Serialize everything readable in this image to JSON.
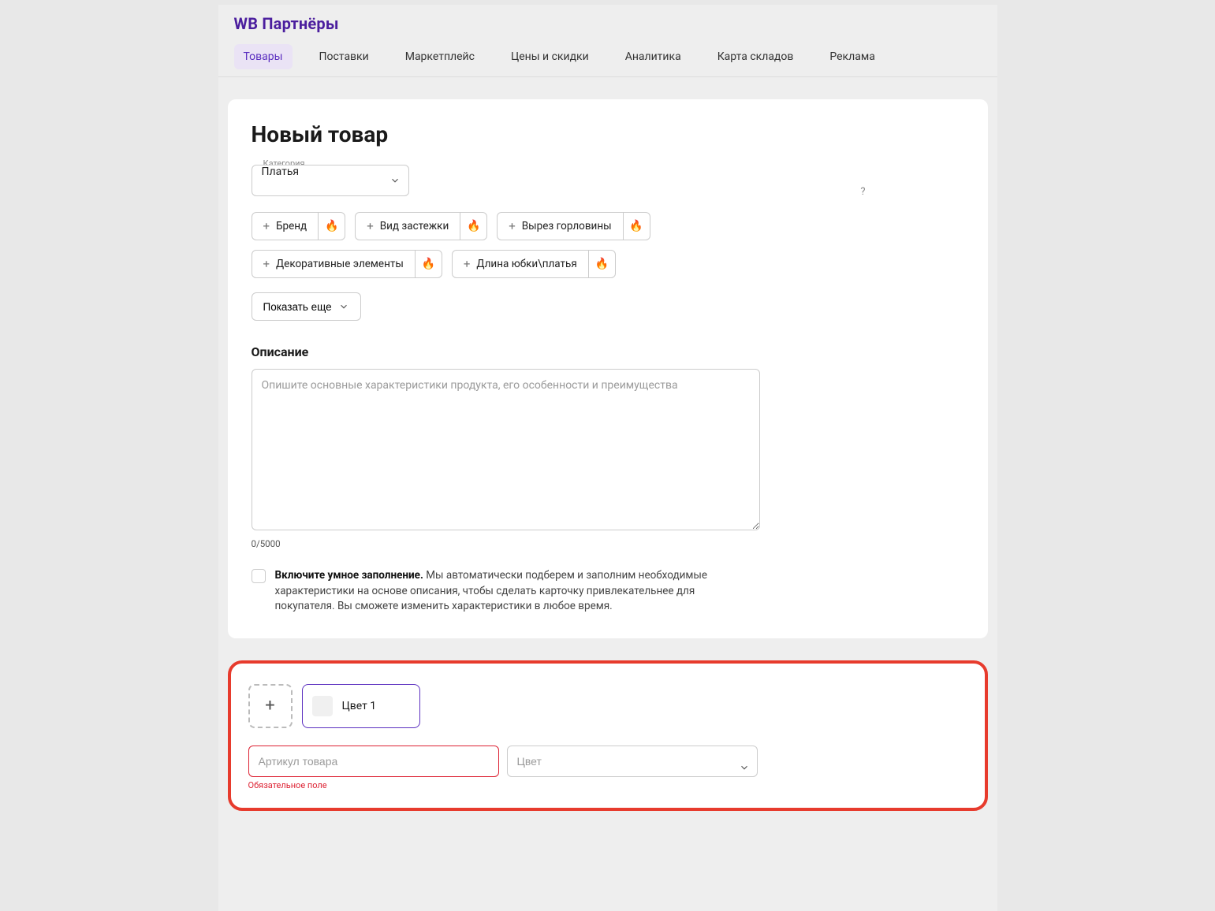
{
  "app_title": "WB Партнёры",
  "nav": {
    "tabs": [
      "Товары",
      "Поставки",
      "Маркетплейс",
      "Цены и скидки",
      "Аналитика",
      "Карта складов",
      "Реклама"
    ],
    "active_index": 0
  },
  "page_title": "Новый товар",
  "category": {
    "label": "Категория",
    "value": "Платья"
  },
  "attr_chips": [
    "Бренд",
    "Вид застежки",
    "Вырез горловины",
    "Декоративные элементы",
    "Длина юбки\\платья"
  ],
  "show_more_label": "Показать еще",
  "help_icon": "?",
  "description": {
    "heading": "Описание",
    "placeholder": "Опишите основные характеристики продукта, его особенности и преимущества",
    "counter": "0/5000"
  },
  "smart_fill": {
    "strong": "Включите умное заполнение.",
    "rest": " Мы автоматически подберем и заполним необходимые характеристики на основе описания, чтобы сделать карточку привлекательнее для покупателя. Вы сможете изменить характеристики в любое время."
  },
  "variant": {
    "color_label": "Цвет 1",
    "sku_placeholder": "Артикул товара",
    "sku_error": "Обязательное поле",
    "color_placeholder": "Цвет"
  }
}
